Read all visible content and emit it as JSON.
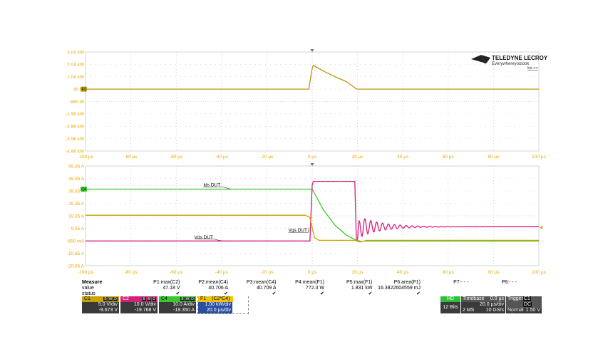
{
  "brand": {
    "name": "TELEDYNE LECROY",
    "tagline": "Everywhereyoulook",
    "link": "list >>"
  },
  "colors": {
    "c1": "#c9a400",
    "c2": "#d61f7a",
    "c4": "#39c829",
    "f1": "#b8950a",
    "grid": "#b8b8b8",
    "axis": "#e6a800"
  },
  "chart_data": [
    {
      "type": "line",
      "name": "top-grid",
      "xlim": [
        -100,
        100
      ],
      "x_ticks": [
        "-100 µs",
        "-80 µs",
        "-60 µs",
        "-40 µs",
        "-20 µs",
        "0 µs",
        "20 µs",
        "40 µs",
        "60 µs",
        "80 µs",
        "100 µs"
      ],
      "y_ticks": [
        "3.04 kW",
        "2.04 kW",
        "1.04 kW",
        "40 W",
        "-960 W",
        "-1.96 kW",
        "-2.96 kW",
        "-3.96 kW",
        "-4.96 kW"
      ],
      "ylim": [
        -4960,
        3040
      ],
      "series": [
        {
          "trace": "F1",
          "color": "#b8950a",
          "x": [
            -100,
            -1.5,
            0,
            0.5,
            2,
            5,
            10,
            15,
            19.5,
            20,
            100
          ],
          "y": [
            40,
            40,
            1700,
            1960,
            1800,
            1500,
            1050,
            650,
            70,
            40,
            40
          ]
        }
      ],
      "marker_label": "F1"
    },
    {
      "type": "line",
      "name": "bottom-grid",
      "xlim": [
        -100,
        100
      ],
      "x_ticks": [
        "-100 µs",
        "-80 µs",
        "-60 µs",
        "-40 µs",
        "-20 µs",
        "0 µs",
        "20 µs",
        "40 µs",
        "60 µs",
        "80 µs",
        "100 µs"
      ],
      "y_ticks": [
        "59.35 A",
        "49.35 A",
        "39.35 A",
        "29.35 A",
        "19.35 A",
        "9.35 A",
        "-650 mA",
        "-10.65 A",
        "-20.65 A"
      ],
      "ylim": [
        -20.65,
        59.35
      ],
      "annotations": [
        {
          "text": "Ids DUT",
          "trace": "C4"
        },
        {
          "text": "Vds DUT",
          "trace": "C2"
        },
        {
          "text": "Vgs DUT",
          "trace": "C1"
        }
      ],
      "series": [
        {
          "trace": "C4",
          "color": "#39c829",
          "x": [
            -100,
            -1,
            0,
            5,
            10,
            15,
            20,
            21,
            23,
            100
          ],
          "y": [
            40.8,
            40.8,
            40.8,
            24,
            12,
            4,
            -0.8,
            -1.6,
            -0.8,
            -0.8
          ]
        },
        {
          "trace": "C2",
          "color": "#d61f7a",
          "x": [
            -100,
            -1,
            0,
            0.5,
            18.8,
            19.5
          ],
          "y": [
            -0.8,
            -0.8,
            44,
            47,
            47,
            -0.8
          ],
          "ringing": {
            "x_start": 20,
            "x_end": 100,
            "settle": 10.6,
            "amp": 9,
            "period": 2.6,
            "decay": 10
          }
        },
        {
          "trace": "C1",
          "color": "#c9a400",
          "x": [
            -100,
            -3,
            -1,
            1,
            3,
            20,
            22,
            24,
            100
          ],
          "y": [
            19.8,
            19.8,
            18,
            2,
            -0.3,
            -0.3,
            -1.4,
            -0.3,
            -0.3
          ]
        }
      ],
      "marker_label": "C4"
    }
  ],
  "measure": {
    "row_labels": [
      "Measure",
      "value",
      "status"
    ],
    "params": [
      {
        "name": "P1:max(C2)",
        "value": "47.18 V",
        "status": "✔"
      },
      {
        "name": "P2:mean(C4)",
        "value": "40.706 A",
        "status": "✔"
      },
      {
        "name": "P3:mean(C4)",
        "value": "40.709 A",
        "status": "✔"
      },
      {
        "name": "P4:mean(F1)",
        "value": "772.3 W",
        "status": "✔"
      },
      {
        "name": "P5:max(F1)",
        "value": "1.831 kW",
        "status": "✔"
      },
      {
        "name": "P6:area(F1)",
        "value": "16.3822604559 mJ",
        "status": "✔"
      },
      {
        "name": "P7:- - -",
        "value": "",
        "status": ""
      },
      {
        "name": "P8:- - -",
        "value": "",
        "status": ""
      }
    ]
  },
  "channels": [
    {
      "label": "C1",
      "vdiv": "5.0 V/div",
      "offset": "-9.673 V",
      "color": "#c9a400"
    },
    {
      "label": "C2",
      "vdiv": "10.0 V/div",
      "offset": "-19.768 V",
      "color": "#d61f7a"
    },
    {
      "label": "C4",
      "vdiv": "10.0 A/div",
      "offset": "-19.350 A",
      "color": "#39c829"
    },
    {
      "label": "F1",
      "expr": "(C2*C4)",
      "vdiv": "1.00 kW/div",
      "offset": "20.0 µs/div",
      "color": "#f2c200"
    }
  ],
  "channel_flags": [
    "B",
    "W",
    "D"
  ],
  "hd": {
    "label": "HD",
    "bits": "12 Bits"
  },
  "timebase": {
    "label": "Timebase",
    "offset": "0.0 µs",
    "tdiv": "20.0 µs/div",
    "points": "2 MS",
    "rate": "10 GS/s"
  },
  "trigger": {
    "label": "Trigger",
    "channels": "C1",
    "dc": "DC",
    "mode": "Normal",
    "level": "1.50 V",
    "type": "Edge",
    "slope": "Neg"
  }
}
